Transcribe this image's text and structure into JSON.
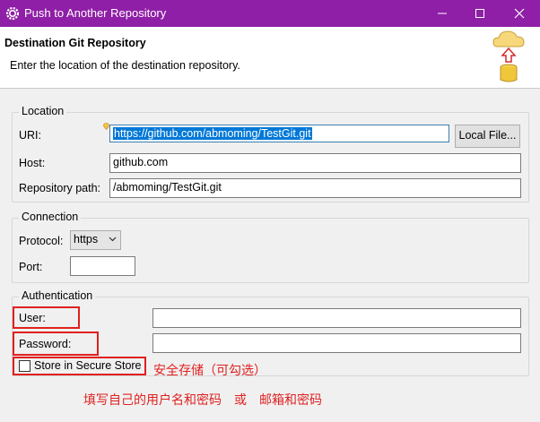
{
  "window": {
    "title": "Push to Another Repository",
    "controls": [
      "minimize-icon",
      "maximize-icon",
      "close-icon"
    ]
  },
  "header": {
    "title": "Destination Git Repository",
    "description": "Enter the location of the destination repository."
  },
  "location": {
    "legend": "Location",
    "uri_label": "URI:",
    "uri_value": "https://github.com/abmoming/TestGit.git",
    "local_file_button": "Local File...",
    "host_label": "Host:",
    "host_value": "github.com",
    "repo_path_label": "Repository path:",
    "repo_path_value": "/abmoming/TestGit.git"
  },
  "connection": {
    "legend": "Connection",
    "protocol_label": "Protocol:",
    "protocol_value": "https",
    "port_label": "Port:",
    "port_value": ""
  },
  "authentication": {
    "legend": "Authentication",
    "user_label": "User:",
    "user_value": "",
    "password_label": "Password:",
    "password_value": "",
    "secure_store_label": "Store in Secure Store",
    "secure_store_checked": false
  },
  "annotations": {
    "secure_store_note": "安全存储（可勾选）",
    "credentials_note": "填写自己的用户名和密码　或　邮箱和密码"
  },
  "colors": {
    "titlebar": "#8f1fa6",
    "annotation_red": "#e02020",
    "selection_blue": "#0078d7"
  }
}
